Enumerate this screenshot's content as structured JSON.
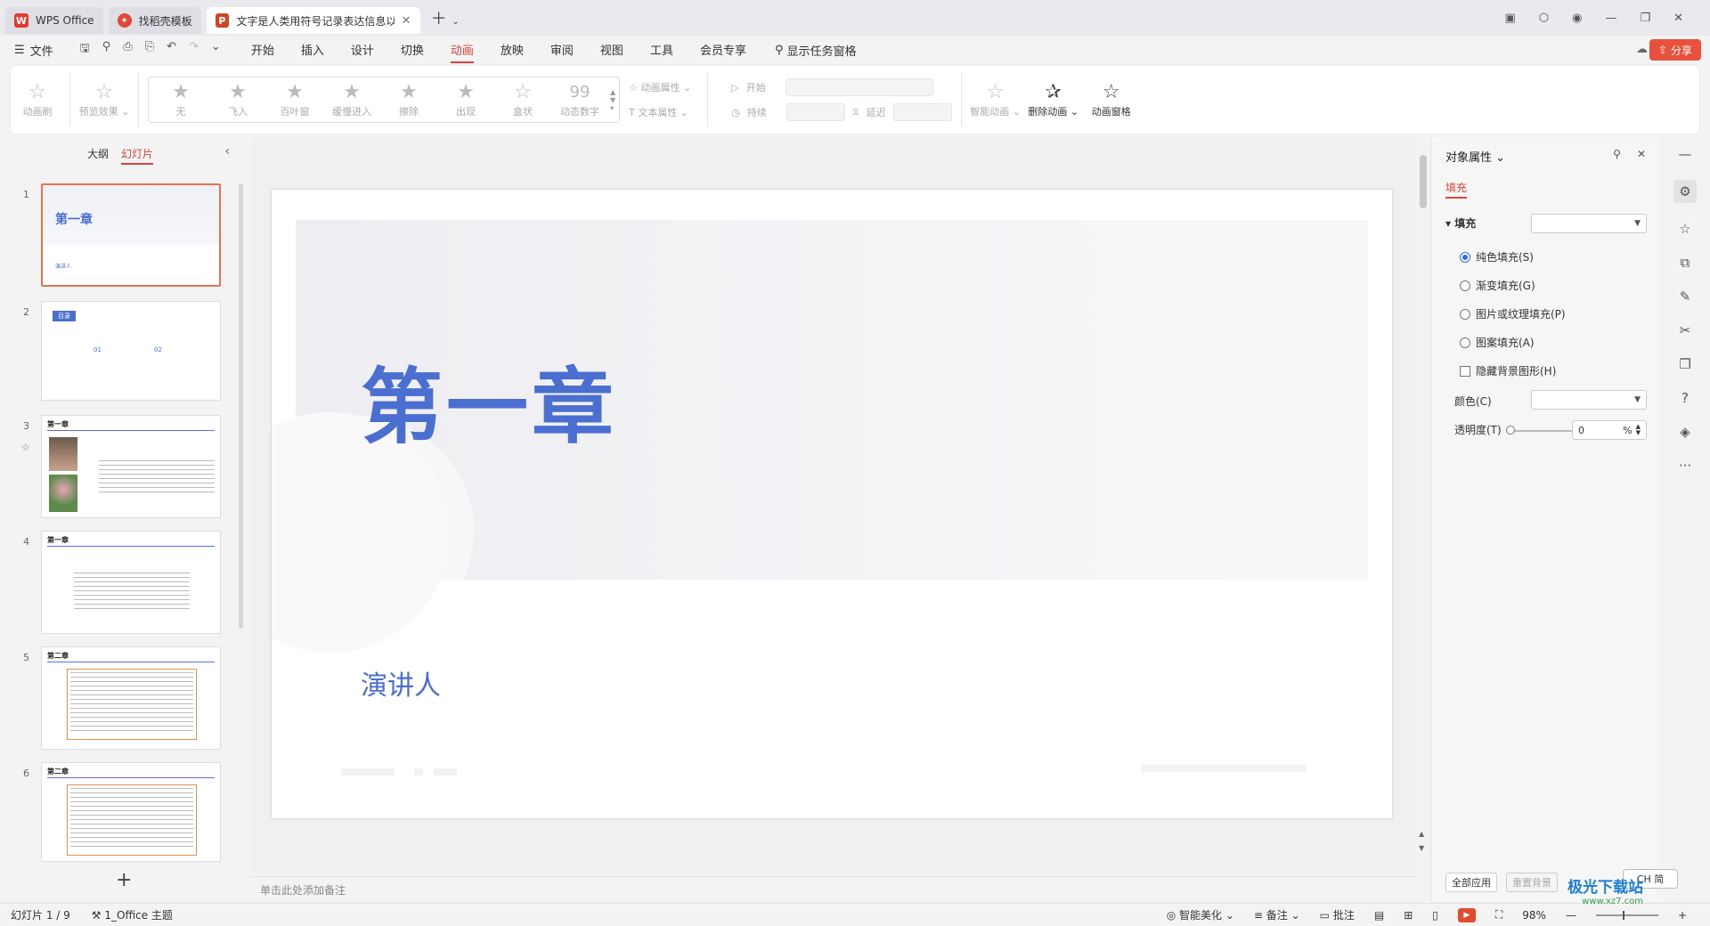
{
  "tabs": [
    {
      "label": "WPS Office"
    },
    {
      "label": "找稻壳模板"
    },
    {
      "label": "文字是人类用符号记录表达信息以"
    }
  ],
  "menubar": {
    "file": "文件",
    "menus": [
      "开始",
      "插入",
      "设计",
      "切换",
      "动画",
      "放映",
      "审阅",
      "视图",
      "工具",
      "会员专享"
    ],
    "active_menu": "动画",
    "task_pane": "显示任务窗格",
    "share": "分享"
  },
  "ribbon": {
    "animation_brush": "动画刷",
    "preview": "预览效果",
    "effects": [
      {
        "label": "无",
        "icon": "star-icon"
      },
      {
        "label": "飞入",
        "icon": "star-icon"
      },
      {
        "label": "百叶窗",
        "icon": "star-icon"
      },
      {
        "label": "缓慢进入",
        "icon": "star-icon"
      },
      {
        "label": "擦除",
        "icon": "star-icon"
      },
      {
        "label": "出现",
        "icon": "star-icon"
      },
      {
        "label": "盒状",
        "icon": "star-icon"
      },
      {
        "label": "动态数字",
        "icon": "number-icon"
      }
    ],
    "anim_props": "动画属性",
    "text_props": "文本属性",
    "start": "开始",
    "duration": "持续",
    "delay": "延迟",
    "smart_anim": "智能动画",
    "delete_anim": "删除动画",
    "anim_pane": "动画窗格"
  },
  "leftpanel": {
    "outline": "大纲",
    "slides_tab": "幻灯片",
    "thumbs": [
      {
        "num": "1",
        "title": "第一章",
        "sub": "演讲人"
      },
      {
        "num": "2",
        "title": "目录",
        "items": [
          "01",
          "02"
        ]
      },
      {
        "num": "3",
        "title": "第一章"
      },
      {
        "num": "4",
        "title": "第一章"
      },
      {
        "num": "5",
        "title": "第二章"
      },
      {
        "num": "6",
        "title": "第二章"
      }
    ]
  },
  "slide": {
    "heading": "第一章",
    "presenter": "演讲人"
  },
  "notes": "单击此处添加备注",
  "rightpane": {
    "title": "对象属性",
    "tab": "填充",
    "section": "填充",
    "options": [
      {
        "label": "纯色填充(S)",
        "type": "radio",
        "checked": true
      },
      {
        "label": "渐变填充(G)",
        "type": "radio",
        "checked": false
      },
      {
        "label": "图片或纹理填充(P)",
        "type": "radio",
        "checked": false
      },
      {
        "label": "图案填充(A)",
        "type": "radio",
        "checked": false
      },
      {
        "label": "隐藏背景图形(H)",
        "type": "checkbox",
        "checked": false
      }
    ],
    "color_label": "颜色(C)",
    "transparency_label": "透明度(T)",
    "transparency_value": "0",
    "transparency_unit": "%",
    "apply_all": "全部应用",
    "reset_bg": "重置背景"
  },
  "ime": "CH 简",
  "statusbar": {
    "slide_count": "幻灯片 1 / 9",
    "theme": "1_Office 主题",
    "smart_beautify": "智能美化",
    "notes": "备注",
    "comments": "批注",
    "zoom": "98%"
  },
  "watermark": {
    "big": "极光下载站",
    "small": "www.xz7.com"
  }
}
